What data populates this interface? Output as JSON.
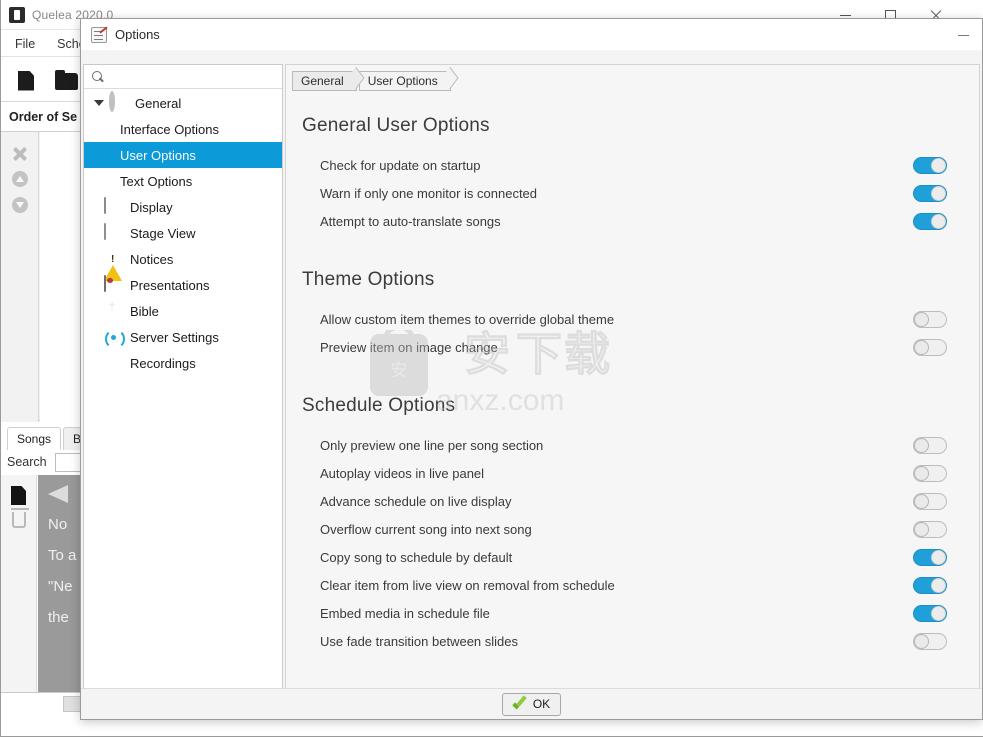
{
  "app": {
    "title": "Quelea 2020.0",
    "icon": "quelea-icon",
    "menu": [
      "File",
      "Sche"
    ],
    "toolbar": [
      {
        "name": "new-schedule-button",
        "icon": "new-file-icon"
      },
      {
        "name": "open-schedule-button",
        "icon": "open-folder-icon"
      }
    ],
    "order_header": "Order of Se",
    "order_buttons": [
      {
        "name": "remove-item-button",
        "icon": "close-x-icon"
      },
      {
        "name": "move-up-button",
        "icon": "arrow-up-circle-icon"
      },
      {
        "name": "move-down-button",
        "icon": "arrow-down-circle-icon"
      }
    ],
    "bottom_tabs": [
      {
        "label": "Songs",
        "active": true
      },
      {
        "label": "Bib",
        "active": false
      }
    ],
    "search_label": "Search",
    "search_value": "",
    "library_buttons": [
      {
        "name": "add-song-button",
        "icon": "document-icon"
      },
      {
        "name": "delete-song-button",
        "icon": "trash-icon"
      }
    ],
    "notice_lines": [
      "No ",
      "To a",
      "\"Ne",
      "the"
    ],
    "window_controls": [
      {
        "name": "minimize-button",
        "icon": "minimize-icon"
      },
      {
        "name": "maximize-button",
        "icon": "maximize-icon"
      },
      {
        "name": "close-button",
        "icon": "close-icon"
      }
    ]
  },
  "dialog": {
    "title": "Options",
    "icon": "options-checklist-icon",
    "minimize_icon": "minimize-icon",
    "search": {
      "placeholder": "",
      "value": "",
      "icon": "search-icon"
    },
    "tree": [
      {
        "label": "General",
        "icon": "gear-icon",
        "level": 0,
        "expanded": true,
        "selected": false
      },
      {
        "label": "Interface Options",
        "icon": null,
        "level": 1,
        "selected": false
      },
      {
        "label": "User Options",
        "icon": null,
        "level": 1,
        "selected": true
      },
      {
        "label": "Text Options",
        "icon": null,
        "level": 1,
        "selected": false
      },
      {
        "label": "Display",
        "icon": "monitor-icon",
        "level": 0,
        "selected": false
      },
      {
        "label": "Stage View",
        "icon": "stage-icon",
        "level": 0,
        "selected": false
      },
      {
        "label": "Notices",
        "icon": "warning-icon",
        "level": 0,
        "selected": false
      },
      {
        "label": "Presentations",
        "icon": "presentation-icon",
        "level": 0,
        "selected": false
      },
      {
        "label": "Bible",
        "icon": "bible-book-icon",
        "level": 0,
        "selected": false
      },
      {
        "label": "Server Settings",
        "icon": "broadcast-icon",
        "level": 0,
        "selected": false
      },
      {
        "label": "Recordings",
        "icon": "record-circle-icon",
        "level": 0,
        "selected": false
      }
    ],
    "breadcrumb": [
      "General",
      "User Options"
    ],
    "sections": [
      {
        "title": "General User Options",
        "options": [
          {
            "label": "Check for update on startup",
            "state": "on"
          },
          {
            "label": "Warn if only one monitor is connected",
            "state": "on"
          },
          {
            "label": "Attempt to auto-translate songs",
            "state": "on"
          }
        ]
      },
      {
        "title": "Theme Options",
        "options": [
          {
            "label": "Allow custom item themes to override global theme",
            "state": "off"
          },
          {
            "label": "Preview item on image change",
            "state": "off"
          }
        ]
      },
      {
        "title": "Schedule Options",
        "options": [
          {
            "label": "Only preview one line per song section",
            "state": "off"
          },
          {
            "label": "Autoplay videos in live panel",
            "state": "off"
          },
          {
            "label": "Advance schedule on live display",
            "state": "off"
          },
          {
            "label": "Overflow current song into next song",
            "state": "off"
          },
          {
            "label": "Copy song to schedule by default",
            "state": "on"
          },
          {
            "label": "Clear item from live view on removal from schedule",
            "state": "on"
          },
          {
            "label": "Embed media in schedule file",
            "state": "on"
          },
          {
            "label": "Use fade transition between slides",
            "state": "off"
          }
        ]
      }
    ],
    "ok_label": "OK",
    "ok_icon": "green-check-icon"
  },
  "watermark": {
    "text": "anxz.com",
    "glyphs": "安下载"
  },
  "colors": {
    "accent_blue": "#0c9ad8",
    "toggle_on": "#20a0d8",
    "toggle_off": "#f0f0f0",
    "selection": "#0c9ad8",
    "dialog_bg": "#f4f4f4"
  }
}
